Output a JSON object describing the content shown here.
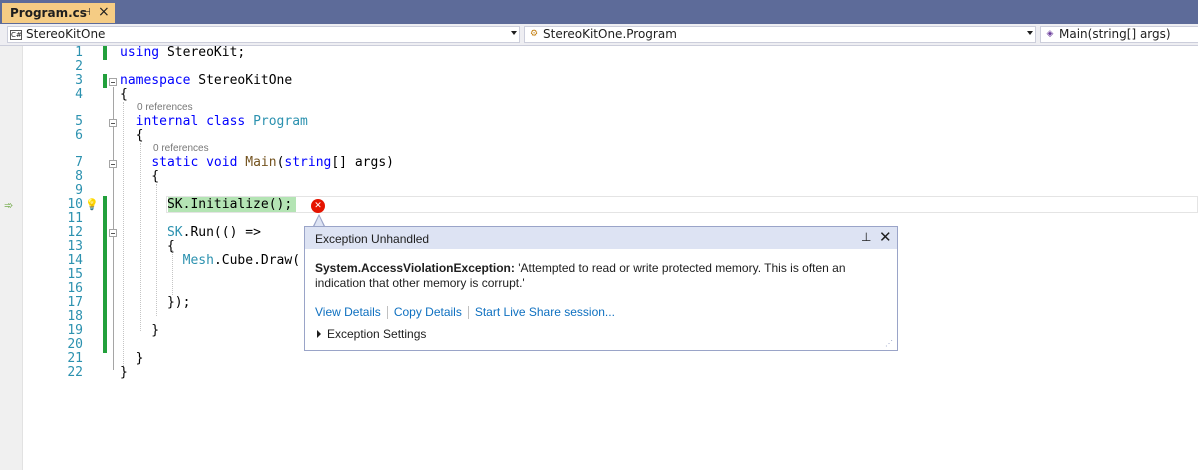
{
  "tab": {
    "title": "Program.cs",
    "pin": "⊣",
    "close": "×"
  },
  "navbar": {
    "project": "StereoKitOne",
    "type": "StereoKitOne.Program",
    "member": "Main(string[] args)"
  },
  "lines": [
    {
      "n": "1",
      "html": "<span class='kw'>using</span> StereoKit;"
    },
    {
      "n": "2",
      "html": ""
    },
    {
      "n": "3",
      "html": "<span class='kw'>namespace</span> StereoKitOne"
    },
    {
      "n": "4",
      "html": "{"
    },
    {
      "n": "5",
      "html": "  <span class='kw'>internal</span> <span class='kw'>class</span> <span class='ty'>Program</span>"
    },
    {
      "n": "6",
      "html": "  {"
    },
    {
      "n": "7",
      "html": "    <span class='kw'>static</span> <span class='kw'>void</span> <span class='mt'>Main</span>(<span class='kw'>string</span>[] args)"
    },
    {
      "n": "8",
      "html": "    {"
    },
    {
      "n": "9",
      "html": ""
    },
    {
      "n": "10",
      "html": "      SK.Initialize();"
    },
    {
      "n": "11",
      "html": ""
    },
    {
      "n": "12",
      "html": "      <span class='ty'>SK</span>.Run(() =>"
    },
    {
      "n": "13",
      "html": "      {"
    },
    {
      "n": "14",
      "html": "        <span class='ty'>Mesh</span>.Cube.Draw("
    },
    {
      "n": "15",
      "html": ""
    },
    {
      "n": "16",
      "html": ""
    },
    {
      "n": "17",
      "html": "      });"
    },
    {
      "n": "18",
      "html": ""
    },
    {
      "n": "19",
      "html": "    }"
    },
    {
      "n": "20",
      "html": ""
    },
    {
      "n": "21",
      "html": "  }"
    },
    {
      "n": "22",
      "html": "}"
    }
  ],
  "refs": {
    "class_refs": "0 references",
    "method_refs": "0 references"
  },
  "popup": {
    "title": "Exception Unhandled",
    "exception_type": "System.AccessViolationException:",
    "message": "'Attempted to read or write protected memory. This is often an indication that other memory is corrupt.'",
    "link_view": "View Details",
    "link_copy": "Copy Details",
    "link_live": "Start Live Share session...",
    "settings": "Exception Settings"
  },
  "colors": {
    "accent_tab": "#f5cc84",
    "tabstrip": "#5d6b99",
    "link": "#0e70c0",
    "error": "#e51400",
    "changed_bar": "#22a03c"
  }
}
